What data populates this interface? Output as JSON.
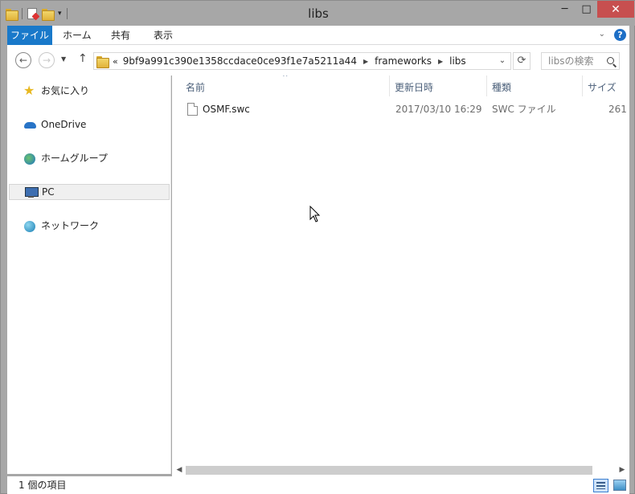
{
  "window": {
    "title": "libs"
  },
  "title_buttons": {
    "minimize": "─",
    "maximize": "□",
    "close": "✕"
  },
  "ribbon": {
    "tabs": [
      "ファイル",
      "ホーム",
      "共有",
      "表示"
    ],
    "help": "?"
  },
  "address": {
    "overflow": "«",
    "crumbs": [
      "9bf9a991c390e1358ccdace0ce93f1e7a5211a44",
      "frameworks",
      "libs"
    ],
    "search_placeholder": "libsの検索"
  },
  "nav_pane": {
    "items": [
      {
        "label": "お気に入り",
        "icon": "star-icon"
      },
      {
        "label": "OneDrive",
        "icon": "cloud-icon"
      },
      {
        "label": "ホームグループ",
        "icon": "homegroup-icon"
      },
      {
        "label": "PC",
        "icon": "pc-icon",
        "selected": true
      },
      {
        "label": "ネットワーク",
        "icon": "network-icon"
      }
    ]
  },
  "columns": {
    "name": "名前",
    "modified": "更新日時",
    "type": "種類",
    "size": "サイズ"
  },
  "files": [
    {
      "name": "OSMF.swc",
      "modified": "2017/03/10 16:29",
      "type": "SWC ファイル",
      "size": "261"
    }
  ],
  "status": {
    "count_text": "1 個の項目"
  },
  "colors": {
    "accent": "#1979ca",
    "close_button": "#c74f4f",
    "header_text": "#4c607a"
  }
}
